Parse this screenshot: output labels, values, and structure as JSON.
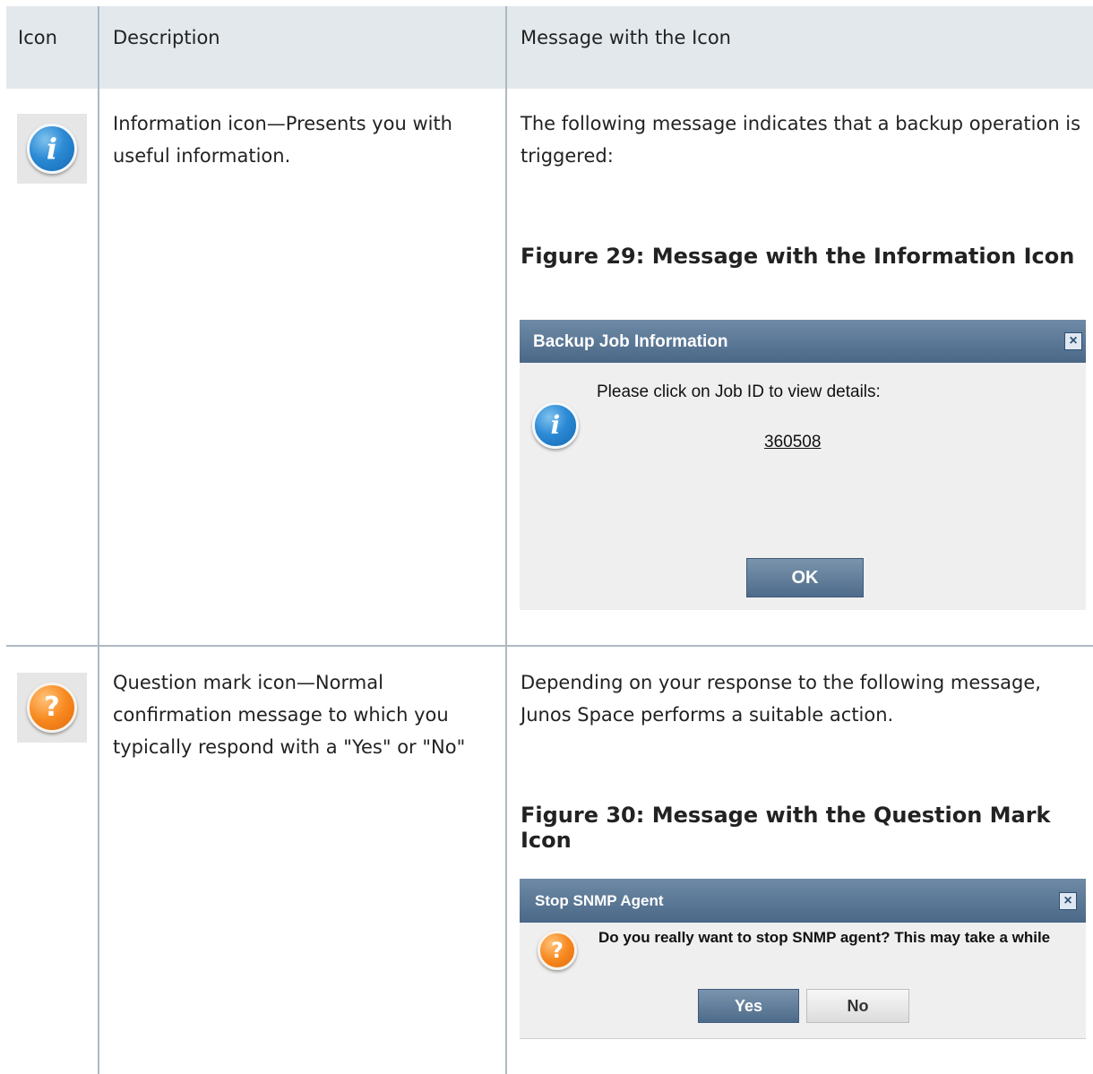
{
  "table": {
    "headers": [
      "Icon",
      "Description",
      "Message with the Icon"
    ],
    "rows": [
      {
        "icon": "info-icon",
        "icon_color": "#2c8ad5",
        "description": "Information icon—Presents you with useful information.",
        "message_intro": "The following message indicates that a backup operation is triggered:",
        "figure_caption": "Figure 29: Message with the Information Icon",
        "dialog": {
          "title": "Backup Job Information",
          "icon": "info-icon",
          "body_text": "Please click on Job ID to view details:",
          "link_text": "360508",
          "ok_label": "OK"
        }
      },
      {
        "icon": "question-mark-icon",
        "icon_color": "#f7891f",
        "description": "Question mark icon—Normal confirmation message to which you typically respond with a \"Yes\" or \"No\"",
        "message_intro": "Depending on your response to the following message, Junos Space performs a suitable action.",
        "figure_caption": "Figure 30: Message with the Question Mark Icon",
        "dialog": {
          "title": "Stop SNMP Agent",
          "icon": "question-mark-icon",
          "body_text": "Do you really want to stop SNMP agent? This may take a while",
          "yes_label": "Yes",
          "no_label": "No"
        }
      }
    ]
  },
  "colors": {
    "header_bg": "#e2e8ec",
    "rule": "#aeb9c3",
    "dialog_title_bar": "#4a6887"
  }
}
